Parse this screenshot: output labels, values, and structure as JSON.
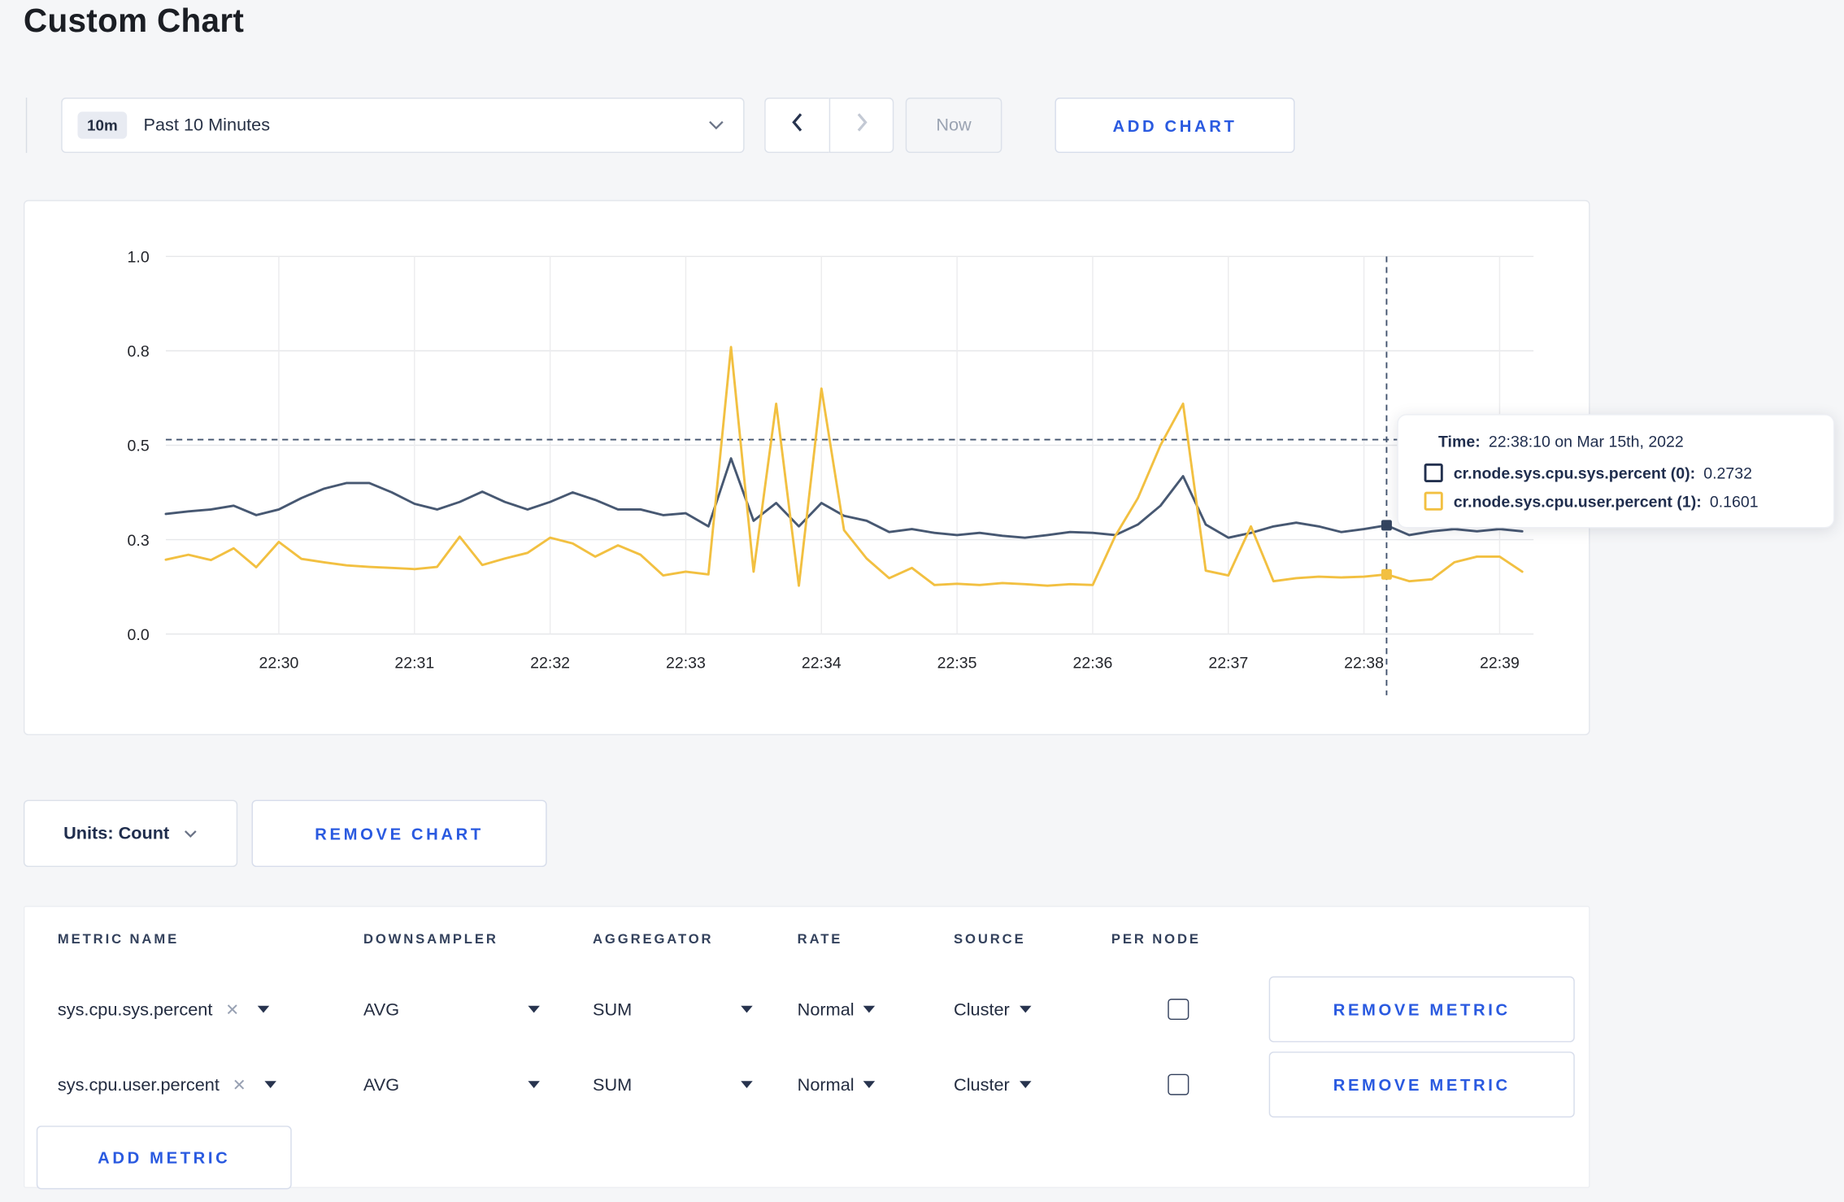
{
  "page": {
    "title": "Custom Chart"
  },
  "toolbar": {
    "time_badge": "10m",
    "time_label": "Past 10 Minutes",
    "now_label": "Now",
    "add_chart_label": "ADD CHART"
  },
  "chart_data": {
    "type": "line",
    "title": "",
    "xlabel": "",
    "ylabel": "",
    "grid": true,
    "legend_position": "tooltip-only",
    "ylim": [
      0,
      1
    ],
    "y_ticks": {
      "values": [
        0,
        0.25,
        0.5,
        0.75,
        1.0
      ],
      "labels": [
        "0.0",
        "0.3",
        "0.5",
        "0.8",
        "1.0"
      ]
    },
    "x_domain_minutes": [
      29.1667,
      39.25
    ],
    "x_ticks": [
      {
        "m": 30,
        "label": "22:30"
      },
      {
        "m": 31,
        "label": "22:31"
      },
      {
        "m": 32,
        "label": "22:32"
      },
      {
        "m": 33,
        "label": "22:33"
      },
      {
        "m": 34,
        "label": "22:34"
      },
      {
        "m": 35,
        "label": "22:35"
      },
      {
        "m": 36,
        "label": "22:36"
      },
      {
        "m": 37,
        "label": "22:37"
      },
      {
        "m": 38,
        "label": "22:38"
      },
      {
        "m": 39,
        "label": "22:39"
      }
    ],
    "series": [
      {
        "name": "cr.node.sys.cpu.sys.percent (0)",
        "color": "#475872",
        "x_start_min": 29.1667,
        "x_step_min": 0.166667,
        "values": [
          0.318,
          0.325,
          0.33,
          0.34,
          0.315,
          0.33,
          0.36,
          0.385,
          0.4,
          0.4,
          0.375,
          0.345,
          0.33,
          0.35,
          0.377,
          0.35,
          0.33,
          0.35,
          0.375,
          0.355,
          0.33,
          0.33,
          0.315,
          0.32,
          0.285,
          0.465,
          0.3,
          0.347,
          0.285,
          0.347,
          0.313,
          0.3,
          0.27,
          0.278,
          0.268,
          0.262,
          0.268,
          0.26,
          0.255,
          0.262,
          0.27,
          0.268,
          0.262,
          0.29,
          0.34,
          0.418,
          0.29,
          0.255,
          0.268,
          0.285,
          0.295,
          0.285,
          0.27,
          0.278,
          0.288,
          0.262,
          0.272,
          0.278,
          0.272,
          0.278,
          0.272
        ]
      },
      {
        "name": "cr.node.sys.cpu.user.percent (1)",
        "color": "#f2c041",
        "x_start_min": 29.1667,
        "x_step_min": 0.166667,
        "values": [
          0.197,
          0.21,
          0.196,
          0.227,
          0.177,
          0.244,
          0.199,
          0.19,
          0.182,
          0.178,
          0.175,
          0.172,
          0.178,
          0.258,
          0.183,
          0.2,
          0.215,
          0.255,
          0.24,
          0.205,
          0.235,
          0.21,
          0.155,
          0.165,
          0.158,
          0.76,
          0.165,
          0.61,
          0.128,
          0.65,
          0.275,
          0.2,
          0.148,
          0.175,
          0.13,
          0.133,
          0.13,
          0.135,
          0.132,
          0.128,
          0.132,
          0.13,
          0.26,
          0.36,
          0.5,
          0.61,
          0.168,
          0.155,
          0.285,
          0.14,
          0.148,
          0.152,
          0.15,
          0.152,
          0.158,
          0.14,
          0.145,
          0.19,
          0.205,
          0.205,
          0.165
        ]
      }
    ],
    "crosshair": {
      "x_min": 38.1667,
      "h_value": 0.515,
      "points": [
        {
          "series": 0,
          "value": 0.288,
          "color": "#33445f"
        },
        {
          "series": 1,
          "value": 0.158,
          "color": "#f2c041"
        }
      ]
    }
  },
  "tooltip": {
    "time_label": "Time:",
    "time_value": "22:38:10 on Mar 15th, 2022",
    "rows": [
      {
        "label": "cr.node.sys.cpu.sys.percent (0):",
        "value": "0.2732",
        "swatch_color": "#22304e"
      },
      {
        "label": "cr.node.sys.cpu.user.percent (1):",
        "value": "0.1601",
        "swatch_color": "#f2c041"
      }
    ]
  },
  "units_row": {
    "units_label": "Units: Count",
    "remove_chart_label": "REMOVE CHART"
  },
  "metrics_table": {
    "headers": [
      "METRIC NAME",
      "DOWNSAMPLER",
      "AGGREGATOR",
      "RATE",
      "SOURCE",
      "PER NODE"
    ],
    "remove_metric_label": "REMOVE METRIC",
    "add_metric_label": "ADD METRIC",
    "rows": [
      {
        "metric": "sys.cpu.sys.percent",
        "downsampler": "AVG",
        "aggregator": "SUM",
        "rate": "Normal",
        "source": "Cluster",
        "per_node_checked": false
      },
      {
        "metric": "sys.cpu.user.percent",
        "downsampler": "AVG",
        "aggregator": "SUM",
        "rate": "Normal",
        "source": "Cluster",
        "per_node_checked": false
      }
    ]
  },
  "icons": {
    "remove_token": "✕"
  },
  "colors": {
    "accent_blue": "#2a5ae0",
    "series_sys": "#475872",
    "series_user": "#f2c041",
    "page_bg": "#f5f6f8"
  }
}
